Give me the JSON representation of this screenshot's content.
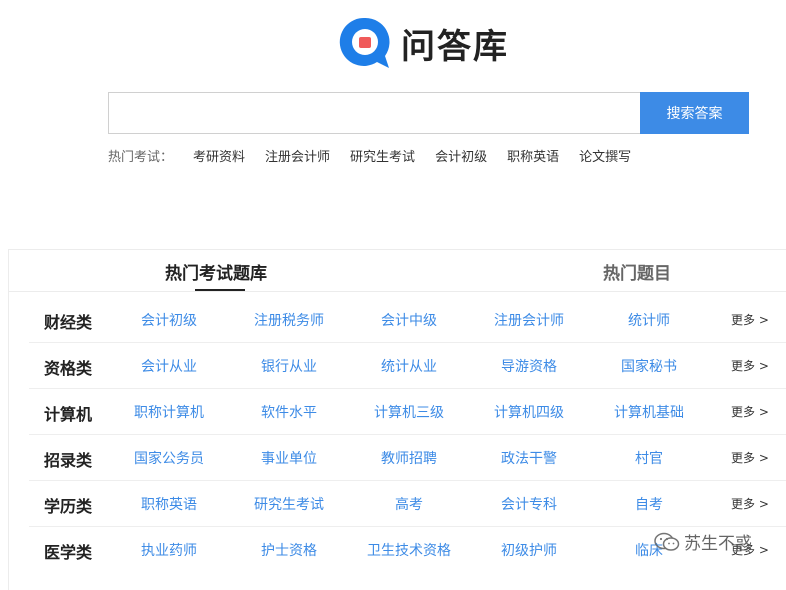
{
  "brand": {
    "name": "问答库",
    "colors": {
      "blue": "#1e7ee8",
      "red": "#f05a5a",
      "accent": "#3d8be6"
    }
  },
  "search": {
    "value": "",
    "placeholder": "",
    "button_label": "搜索答案"
  },
  "hot_exams": {
    "label": "热门考试：",
    "items": [
      "考研资料",
      "注册会计师",
      "研究生考试",
      "会计初级",
      "职称英语",
      "论文撰写"
    ]
  },
  "panel": {
    "tabs": [
      {
        "label": "热门考试题库",
        "active": true
      },
      {
        "label": "热门题目",
        "active": false
      }
    ],
    "rows": [
      {
        "title": "财经类",
        "links": [
          "会计初级",
          "注册税务师",
          "会计中级",
          "注册会计师",
          "统计师"
        ],
        "more": "更多 >"
      },
      {
        "title": "资格类",
        "links": [
          "会计从业",
          "银行从业",
          "统计从业",
          "导游资格",
          "国家秘书"
        ],
        "more": "更多 >"
      },
      {
        "title": "计算机",
        "links": [
          "职称计算机",
          "软件水平",
          "计算机三级",
          "计算机四级",
          "计算机基础"
        ],
        "more": "更多 >"
      },
      {
        "title": "招录类",
        "links": [
          "国家公务员",
          "事业单位",
          "教师招聘",
          "政法干警",
          "村官"
        ],
        "more": "更多 >"
      },
      {
        "title": "学历类",
        "links": [
          "职称英语",
          "研究生考试",
          "高考",
          "会计专科",
          "自考"
        ],
        "more": "更多 >"
      },
      {
        "title": "医学类",
        "links": [
          "执业药师",
          "护士资格",
          "卫生技术资格",
          "初级护师",
          "临床"
        ],
        "more": "更多 >"
      }
    ]
  },
  "watermark": {
    "text": "苏生不惑",
    "icon": "wechat-icon"
  }
}
